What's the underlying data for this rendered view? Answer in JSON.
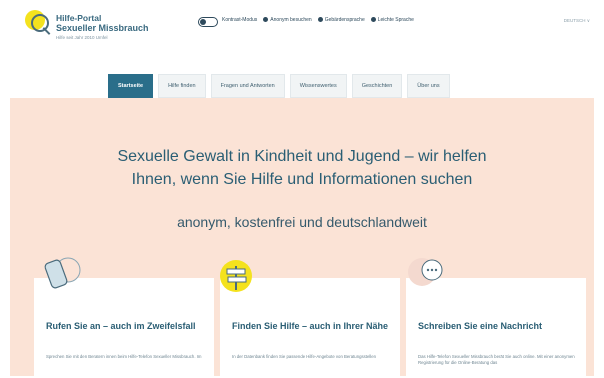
{
  "brand": {
    "line1": "Hilfe-Portal",
    "line2": "Sexueller Missbrauch",
    "sub": "Hilfe seit Jahr 2010 Umfel"
  },
  "toolbar": {
    "items": [
      "Kontrast-Modus",
      "Anonym besuchen",
      "Gebärdensprache",
      "Leichte Sprache"
    ],
    "language": "DEUTSCH ∨"
  },
  "nav": {
    "tabs": [
      "Startseite",
      "Hilfe finden",
      "Fragen und Antworten",
      "Wissenswertes",
      "Geschichten",
      "Über uns"
    ]
  },
  "hero": {
    "headline1": "Sexuelle Gewalt in Kindheit und Jugend – wir helfen",
    "headline2": "Ihnen, wenn Sie Hilfe und Informationen suchen",
    "tagline": "anonym, kostenfrei und deutschlandweit"
  },
  "cards": [
    {
      "title": "Rufen Sie an – auch im Zweifelsfall",
      "text": "Sprechen Sie mit den Beratern innen beim Hilfe-Telefon Sexueller Missbrauch. Im",
      "icon": "phone-icon"
    },
    {
      "title": "Finden Sie Hilfe – auch in Ihrer Nähe",
      "text": "In der Datenbank finden Sie passende Hilfe-Angebote von Beratungsstellen",
      "icon": "signpost-icon"
    },
    {
      "title": "Schreiben Sie eine Nachricht",
      "text": "Das Hilfe-Telefon Sexueller Missbrauch berät Sie auch online. Mit einer anonymen Registrierung für die Online-Beratung das",
      "icon": "chat-icon"
    }
  ],
  "colors": {
    "accent": "#2a6e8a",
    "hero_bg": "#fbe3d6",
    "brand_yellow": "#f4e21e"
  }
}
